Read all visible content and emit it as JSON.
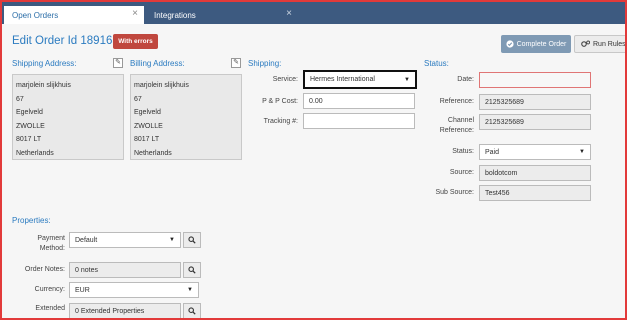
{
  "tabs": [
    {
      "label": "Open Orders",
      "close": "×"
    },
    {
      "label": "Integrations",
      "close": "×"
    }
  ],
  "header": {
    "title": "Edit Order Id 189163",
    "error_badge": "With errors",
    "complete_label": "Complete Order",
    "rules_label": "Run Rules"
  },
  "shipping_address": {
    "label": "Shipping Address:",
    "lines": [
      "marjolein slijkhuis",
      "67",
      "Egelveld",
      "ZWOLLE",
      "8017 LT",
      "Netherlands"
    ]
  },
  "billing_address": {
    "label": "Billing Address:",
    "lines": [
      "marjolein slijkhuis",
      "67",
      "Egelveld",
      "ZWOLLE",
      "8017 LT",
      "Netherlands"
    ]
  },
  "shipping": {
    "label": "Shipping:",
    "service_label": "Service:",
    "service_value": "Hermes International",
    "pp_cost_label": "P & P Cost:",
    "pp_cost_value": "0.00",
    "tracking_label": "Tracking #:",
    "tracking_value": ""
  },
  "status": {
    "label": "Status:",
    "date_label": "Date:",
    "date_value": "",
    "reference_label": "Reference:",
    "reference_value": "2125325689",
    "channel_ref_label_1": "Channel",
    "channel_ref_label_2": "Reference:",
    "channel_ref_value": "2125325689",
    "status_label": "Status:",
    "status_value": "Paid",
    "source_label": "Source:",
    "source_value": "boldotcom",
    "subsource_label": "Sub Source:",
    "subsource_value": "Test456"
  },
  "properties": {
    "label": "Properties:",
    "payment_label_1": "Payment",
    "payment_label_2": "Method:",
    "payment_value": "Default",
    "notes_label": "Order Notes:",
    "notes_value": "0 notes",
    "currency_label": "Currency:",
    "currency_value": "EUR",
    "extended_label": "Extended",
    "extended_value": "0 Extended Properties"
  },
  "colors": {
    "frame_border": "#e23a3a",
    "tabbar": "#3d5a80",
    "accent": "#2b7bc0",
    "error_badge": "#c0473e",
    "complete_button": "#7f9ab4"
  }
}
